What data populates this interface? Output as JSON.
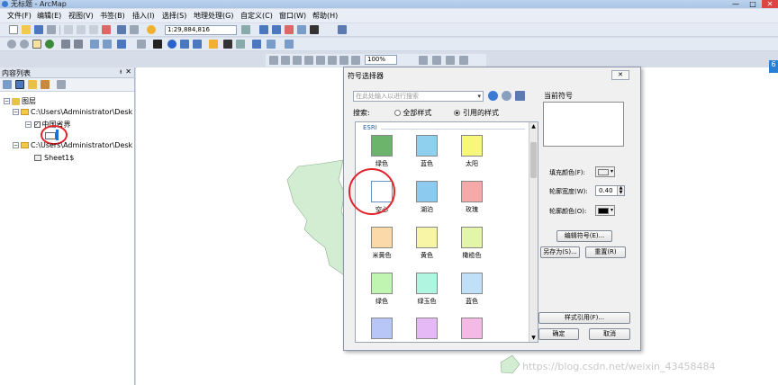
{
  "window": {
    "title": "无标题 - ArcMap",
    "controls": [
      "—",
      "□",
      "✕"
    ]
  },
  "menubar": {
    "items": [
      "文件(F)",
      "编辑(E)",
      "视图(V)",
      "书签(B)",
      "插入(I)",
      "选择(S)",
      "地理处理(G)",
      "自定义(C)",
      "窗口(W)",
      "帮助(H)"
    ]
  },
  "toolbar": {
    "scale": "1:29,884,816",
    "zoom_percent": "100%"
  },
  "toc": {
    "title": "内容列表",
    "pin": "ᵼ",
    "close": "✕",
    "tree": {
      "root": "图层",
      "folder1": "C:\\Users\\Administrator\\Desk",
      "layer_name": "中国省界",
      "folder2": "C:\\Users\\Administrator\\Desk",
      "table_name": "Sheet1$"
    }
  },
  "dialog": {
    "title": "符号选择器",
    "search_placeholder": "在此处输入以进行搜索",
    "search_label": "搜索:",
    "radio_all": "全部样式",
    "radio_ref": "引用的样式",
    "group": "ESRI",
    "symbols": [
      {
        "label": "绿色",
        "color": "#6cb46c"
      },
      {
        "label": "蓝色",
        "color": "#8fd0ef"
      },
      {
        "label": "太阳",
        "color": "#f7f77a"
      },
      {
        "label": "空心",
        "color": "#ffffff"
      },
      {
        "label": "湖泊",
        "color": "#8ccbef"
      },
      {
        "label": "玫瑰",
        "color": "#f5a9a9"
      },
      {
        "label": "米黄色",
        "color": "#fbd9a8"
      },
      {
        "label": "黄色",
        "color": "#f9f5a6"
      },
      {
        "label": "橄榄色",
        "color": "#e2f5a8"
      },
      {
        "label": "绿色",
        "color": "#bff5b0"
      },
      {
        "label": "绿玉色",
        "color": "#aff5df"
      },
      {
        "label": "蓝色",
        "color": "#bfe0f7"
      },
      {
        "label": "",
        "color": "#b7c6f7"
      },
      {
        "label": "",
        "color": "#e4b9f5"
      },
      {
        "label": "",
        "color": "#f5b9e6"
      }
    ],
    "current_symbol_label": "当前符号",
    "fill_color_label": "填充颜色(F):",
    "fill_color_value": "#eeeeee",
    "outline_width_label": "轮廓宽度(W):",
    "outline_width_value": "0.40",
    "outline_color_label": "轮廓颜色(O):",
    "outline_color_value": "#000000",
    "edit_symbol_button": "编辑符号(E)...",
    "save_as_button": "另存为(S)...",
    "reset_button": "重置(R)",
    "style_refs_button": "样式引用(F)...",
    "ok_button": "确定",
    "cancel_button": "取消",
    "close_icon": "✕"
  },
  "watermark": "https://blog.csdn.net/weixin_43458484",
  "colors": {
    "map_polygon": "#d2edd2",
    "annotation": "#e3232b"
  }
}
